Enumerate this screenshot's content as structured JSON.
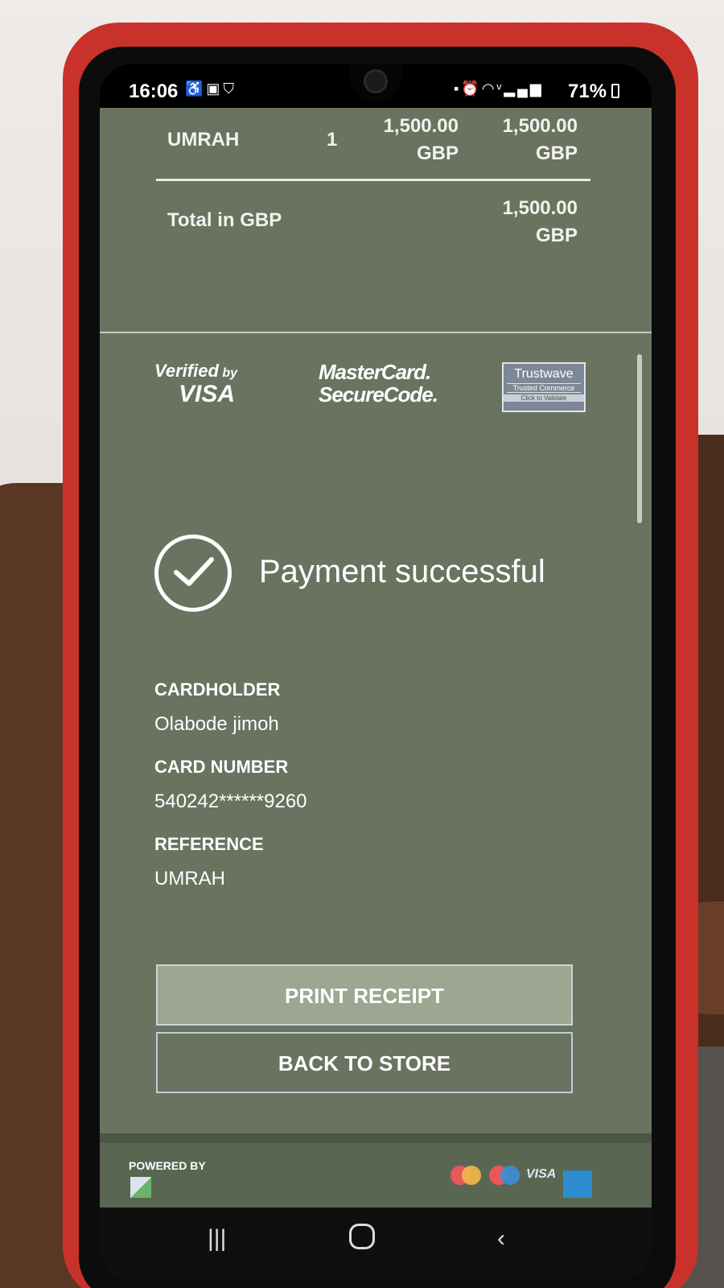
{
  "status_bar": {
    "time": "16:06",
    "battery": "71%",
    "left_icons": [
      "accessibility-icon",
      "outlook-icon",
      "shield-icon"
    ],
    "right_icons": [
      "battery-saver-icon",
      "alarm-icon",
      "wifi-icon",
      "volte-icon",
      "signal-icon"
    ]
  },
  "invoice": {
    "item": "UMRAH",
    "quantity": "1",
    "unit_price_line1": "1,500.00",
    "unit_price_line2": "GBP",
    "amount_line1": "1,500.00",
    "amount_line2": "GBP",
    "total_label": "Total in GBP",
    "total_line1": "1,500.00",
    "total_line2": "GBP"
  },
  "badges": {
    "visa_l1": "Verified",
    "visa_by": "by",
    "visa_l2": "VISA",
    "mc_l1": "MasterCard.",
    "mc_l2": "SecureCode.",
    "tw_l1": "Trustwave",
    "tw_l2": "Trusted Commerce",
    "tw_l3": "Click to Validate"
  },
  "result": {
    "message": "Payment successful"
  },
  "details": {
    "cardholder_label": "CARDHOLDER",
    "cardholder_value": "Olabode jimoh",
    "card_number_label": "CARD NUMBER",
    "card_number_value": "540242******9260",
    "reference_label": "REFERENCE",
    "reference_value": "UMRAH"
  },
  "actions": {
    "print_label": "PRINT RECEIPT",
    "back_label": "BACK TO STORE"
  },
  "footer": {
    "powered_by": "POWERED BY",
    "visa": "VISA"
  },
  "colors": {
    "page_bg": "#6a7260",
    "footer_bg": "#596752",
    "case": "#c9322a"
  }
}
